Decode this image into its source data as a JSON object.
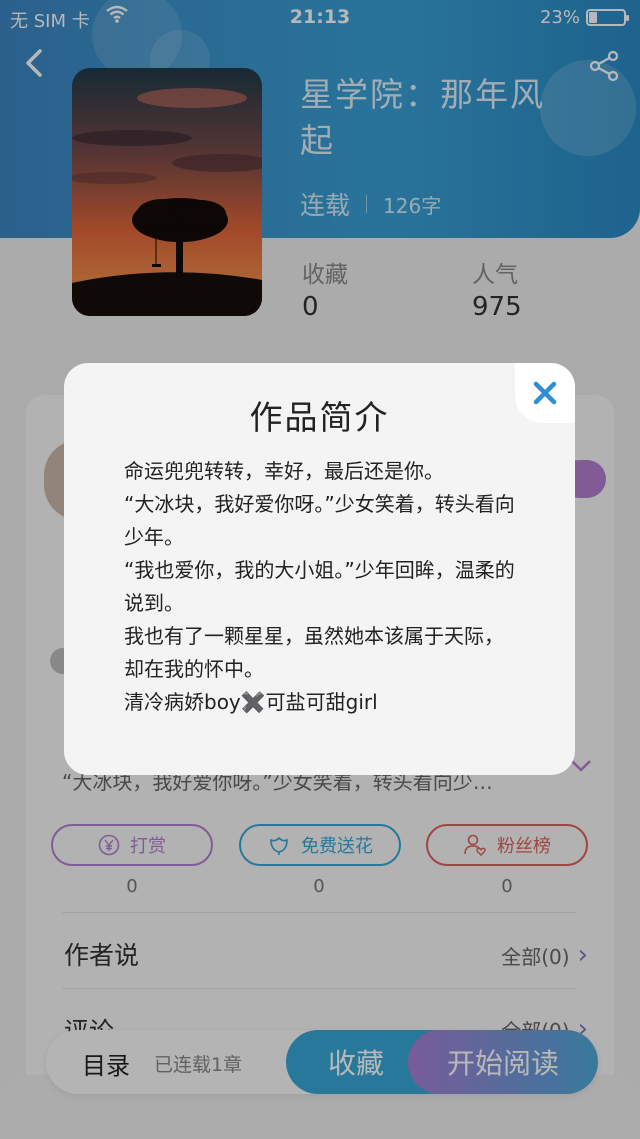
{
  "status_bar": {
    "carrier": "无 SIM 卡",
    "time": "21:13",
    "battery": "23%",
    "battery_level": 0.23
  },
  "book": {
    "title": "星学院：那年风起",
    "status": "连载",
    "word_count": "126字",
    "stats": [
      {
        "label": "收藏",
        "value": "0"
      },
      {
        "label": "人气",
        "value": "975"
      }
    ]
  },
  "background_card": {
    "intro_preview": "“大冰块，我好爱你呀。”少女笑着，转头看向少…",
    "actions": [
      {
        "label": "打赏",
        "count": "0",
        "color": "#b37fd0",
        "icon": "yen-icon"
      },
      {
        "label": "免费送花",
        "count": "0",
        "color": "#37a7d7",
        "icon": "flower-icon"
      },
      {
        "label": "粉丝榜",
        "count": "0",
        "color": "#e0605a",
        "icon": "fans-icon"
      }
    ],
    "sections": [
      {
        "title": "作者说",
        "all": "全部(0)"
      },
      {
        "title": "评论",
        "all": "全部(0)"
      }
    ]
  },
  "bottom_bar": {
    "toc": "目录",
    "progress": "已连载1章",
    "favorite": "收藏",
    "start_reading": "开始阅读"
  },
  "modal": {
    "title": "作品简介",
    "lines": [
      "命运兜兜转转，幸好，最后还是你。",
      "“大冰块，我好爱你呀。”少女笑着，转头看向少年。",
      "“我也爱你，我的大小姐。”少年回眸，温柔的说到。",
      "我也有了一颗星星，虽然她本该属于天际，却在我的怀中。",
      "清冷病娇boy✖️可盐可甜girl"
    ]
  }
}
